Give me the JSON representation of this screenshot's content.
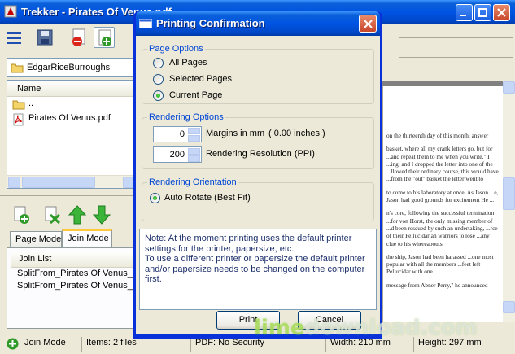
{
  "window": {
    "title": "Trekker - Pirates Of Venus.pdf"
  },
  "left_panel": {
    "path": "EdgarRiceBurroughs",
    "file_list": {
      "column": "Name",
      "items": [
        "..",
        "Pirates Of Venus.pdf"
      ]
    },
    "tabs": [
      "Page Mode",
      "Join Mode"
    ],
    "active_tab": "Join Mode",
    "join_list": {
      "column": "Join List",
      "items": [
        "SplitFrom_Pirates Of Venus_(d",
        "SplitFrom_Pirates Of Venus_(d"
      ]
    }
  },
  "document_text": [
    "on the thirteenth day of this month, answer",
    "basket, where all my crank letters go, but for ...and repeat them to me when you write.\" I ...ing, and I dropped the letter into one of the ...llowed their ordinary course, this would have ...from the \"out\" basket the letter went to",
    "to come to his laboratory at once. As Jason ...e, Jason had good grounds for excitement He ...",
    "n's core, following the successful termination ...for von Horst, the only missing member of ...d been rescued by such an undertaking, ...rce of their Pellucidarian warriors to lose ...any clue to his whereabouts.",
    "the ship, Jason had been harassed ...one most popular with all the members ...feet left Pellucidar with one ...",
    "message from Abner Perry,\" he announced"
  ],
  "dialog": {
    "title": "Printing Confirmation",
    "page_options": {
      "legend": "Page Options",
      "choices": [
        "All Pages",
        "Selected Pages",
        "Current Page"
      ],
      "selected": "Current Page"
    },
    "rendering_options": {
      "legend": "Rendering Options",
      "margins_value": "0",
      "margins_label": "Margins in mm",
      "margins_inches": "( 0.00 inches )",
      "resolution_value": "200",
      "resolution_label": "Rendering Resolution (PPI)"
    },
    "rendering_orientation": {
      "legend": "Rendering Orientation",
      "choice": "Auto Rotate (Best Fit)"
    },
    "note": "Note: At the moment printing uses the default printer settings for the printer, papersize, etc.\nTo use a different printer or papersize the default printer and/or papersize needs to be changed on the computer first.",
    "buttons": {
      "print": "Print",
      "cancel": "Cancel"
    }
  },
  "statusbar": {
    "mode": "Join Mode",
    "items": "Items: 2 files",
    "pdf": "PDF: No Security",
    "width": "Width: 210 mm",
    "height": "Height: 297 mm"
  },
  "watermark": {
    "part1": "lime",
    "part2": "download.com"
  },
  "colors": {
    "xp_blue": "#0054e3",
    "group_legend": "#0046d5",
    "radio_green": "#21a121"
  }
}
